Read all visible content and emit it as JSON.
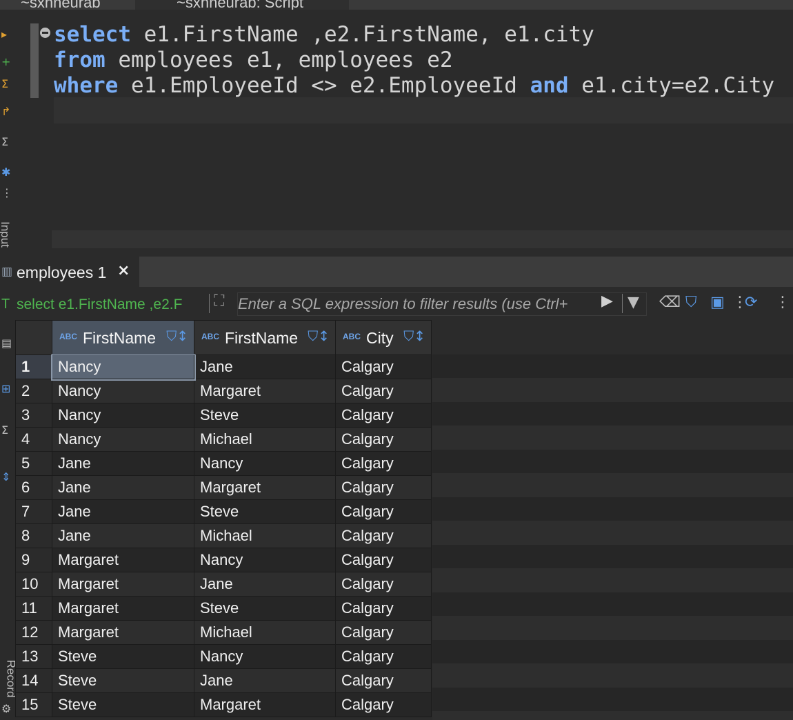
{
  "top_tabs": {
    "first": "~sxnneurab",
    "second": "~sxnneurab: Script"
  },
  "side_labels": {
    "upper": "Input",
    "lower": "Record"
  },
  "editor": {
    "lines": [
      [
        {
          "k": true,
          "t": "select"
        },
        {
          "k": false,
          "t": " e1.FirstName ,e2.FirstName, e1.city"
        }
      ],
      [
        {
          "k": true,
          "t": "from"
        },
        {
          "k": false,
          "t": " employees e1, employees e2"
        }
      ],
      [
        {
          "k": true,
          "t": "where"
        },
        {
          "k": false,
          "t": " e1.EmployeeId <> e2.EmployeeId "
        },
        {
          "k": true,
          "t": "and"
        },
        {
          "k": false,
          "t": " e1.city=e2.City"
        }
      ]
    ]
  },
  "results_tab": {
    "label": "employees 1",
    "close": "×"
  },
  "filter": {
    "query_prefix": "T",
    "query_text": "select e1.FirstName ,e2.F",
    "placeholder": "Enter a SQL expression to filter results (use Ctrl+"
  },
  "columns": [
    {
      "type": "ABC",
      "name": "FirstName"
    },
    {
      "type": "ABC",
      "name": "FirstName"
    },
    {
      "type": "ABC",
      "name": "City"
    }
  ],
  "rows": [
    [
      "Nancy",
      "Jane",
      "Calgary"
    ],
    [
      "Nancy",
      "Margaret",
      "Calgary"
    ],
    [
      "Nancy",
      "Steve",
      "Calgary"
    ],
    [
      "Nancy",
      "Michael",
      "Calgary"
    ],
    [
      "Jane",
      "Nancy",
      "Calgary"
    ],
    [
      "Jane",
      "Margaret",
      "Calgary"
    ],
    [
      "Jane",
      "Steve",
      "Calgary"
    ],
    [
      "Jane",
      "Michael",
      "Calgary"
    ],
    [
      "Margaret",
      "Nancy",
      "Calgary"
    ],
    [
      "Margaret",
      "Jane",
      "Calgary"
    ],
    [
      "Margaret",
      "Steve",
      "Calgary"
    ],
    [
      "Margaret",
      "Michael",
      "Calgary"
    ],
    [
      "Steve",
      "Nancy",
      "Calgary"
    ],
    [
      "Steve",
      "Jane",
      "Calgary"
    ],
    [
      "Steve",
      "Margaret",
      "Calgary"
    ]
  ],
  "colors": {
    "keyword": "#7aaef6",
    "query_green": "#4fb54f",
    "selected_header": "#4a5461"
  }
}
